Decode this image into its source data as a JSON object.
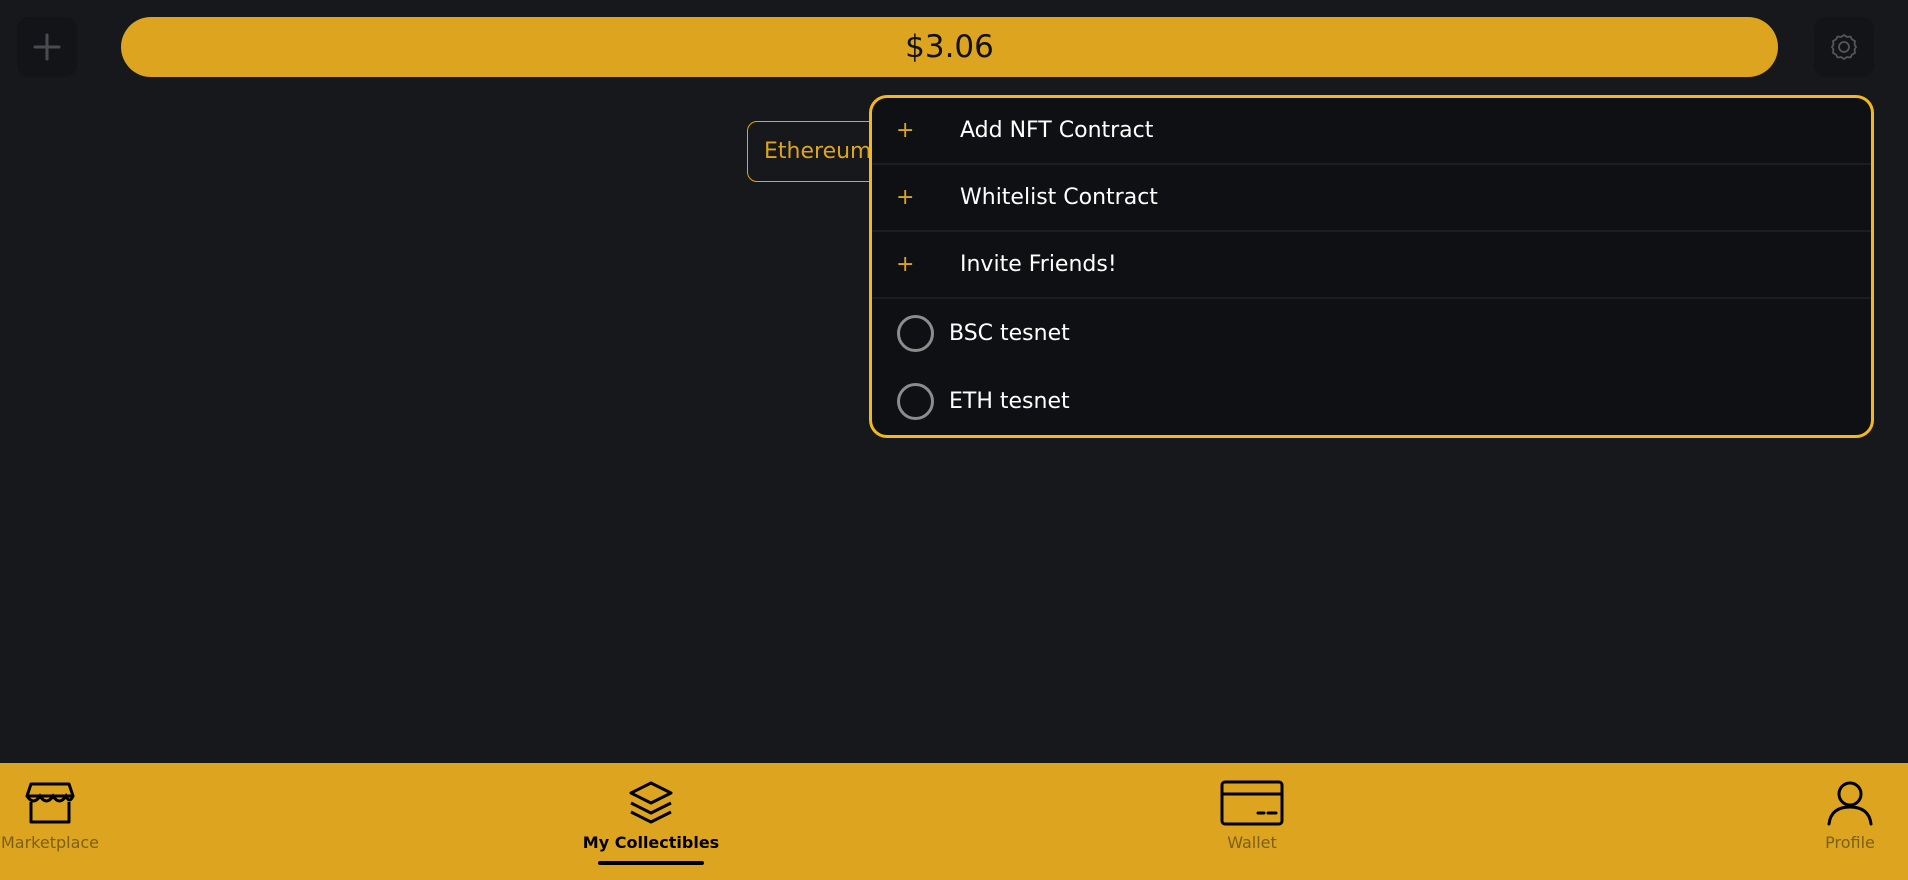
{
  "header": {
    "add_icon": "plus-icon",
    "balance": "$3.06",
    "settings_icon": "gear-icon"
  },
  "network": {
    "selected": "Ethereum"
  },
  "menu": {
    "actions": [
      {
        "label": "Add NFT Contract",
        "icon": "+"
      },
      {
        "label": "Whitelist Contract",
        "icon": "+"
      },
      {
        "label": "Invite Friends!",
        "icon": "+"
      }
    ],
    "networks": [
      {
        "label": "BSC tesnet",
        "selected": false
      },
      {
        "label": "ETH tesnet",
        "selected": false
      }
    ]
  },
  "bottom_nav": {
    "items": [
      {
        "label": "Marketplace",
        "icon": "store-icon",
        "active": false
      },
      {
        "label": "My Collectibles",
        "icon": "layers-icon",
        "active": true
      },
      {
        "label": "Wallet",
        "icon": "card-icon",
        "active": false
      },
      {
        "label": "Profile",
        "icon": "user-icon",
        "active": false
      }
    ]
  },
  "colors": {
    "accent": "#dca41f",
    "menu_border": "#f1b81f",
    "background": "#17181c"
  }
}
